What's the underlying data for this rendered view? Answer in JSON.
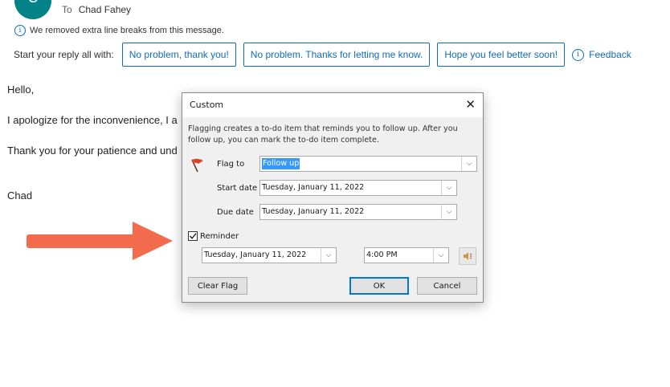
{
  "header": {
    "avatar_initial": "C",
    "to_label": "To",
    "to_name": "Chad Fahey"
  },
  "notice": {
    "text": "We removed extra line breaks from this message."
  },
  "reply": {
    "label": "Start your reply all with:",
    "suggestions": [
      "No problem, thank you!",
      "No problem. Thanks for letting me know.",
      "Hope you feel better soon!"
    ],
    "feedback_label": "Feedback"
  },
  "message": {
    "greeting": "Hello,",
    "line1": "I apologize for the inconvenience, I a",
    "line2": "Thank you for your patience and und",
    "signature": "Chad"
  },
  "dialog": {
    "title": "Custom",
    "description": "Flagging creates a to-do item that reminds you to follow up. After you follow up, you can mark the to-do item complete.",
    "flag_to_label": "Flag to",
    "flag_to_value": "Follow up",
    "start_date_label": "Start date",
    "start_date_value": "Tuesday, January 11, 2022",
    "due_date_label": "Due date",
    "due_date_value": "Tuesday, January 11, 2022",
    "reminder_label": "Reminder",
    "reminder_checked": true,
    "reminder_date_value": "Tuesday, January 11, 2022",
    "reminder_time_value": "4:00 PM",
    "clear_flag_label": "Clear Flag",
    "ok_label": "OK",
    "cancel_label": "Cancel"
  },
  "colors": {
    "accent": "#0f6cbd",
    "avatar": "#038387",
    "arrow": "#f26b4d",
    "selection": "#3399ff"
  }
}
